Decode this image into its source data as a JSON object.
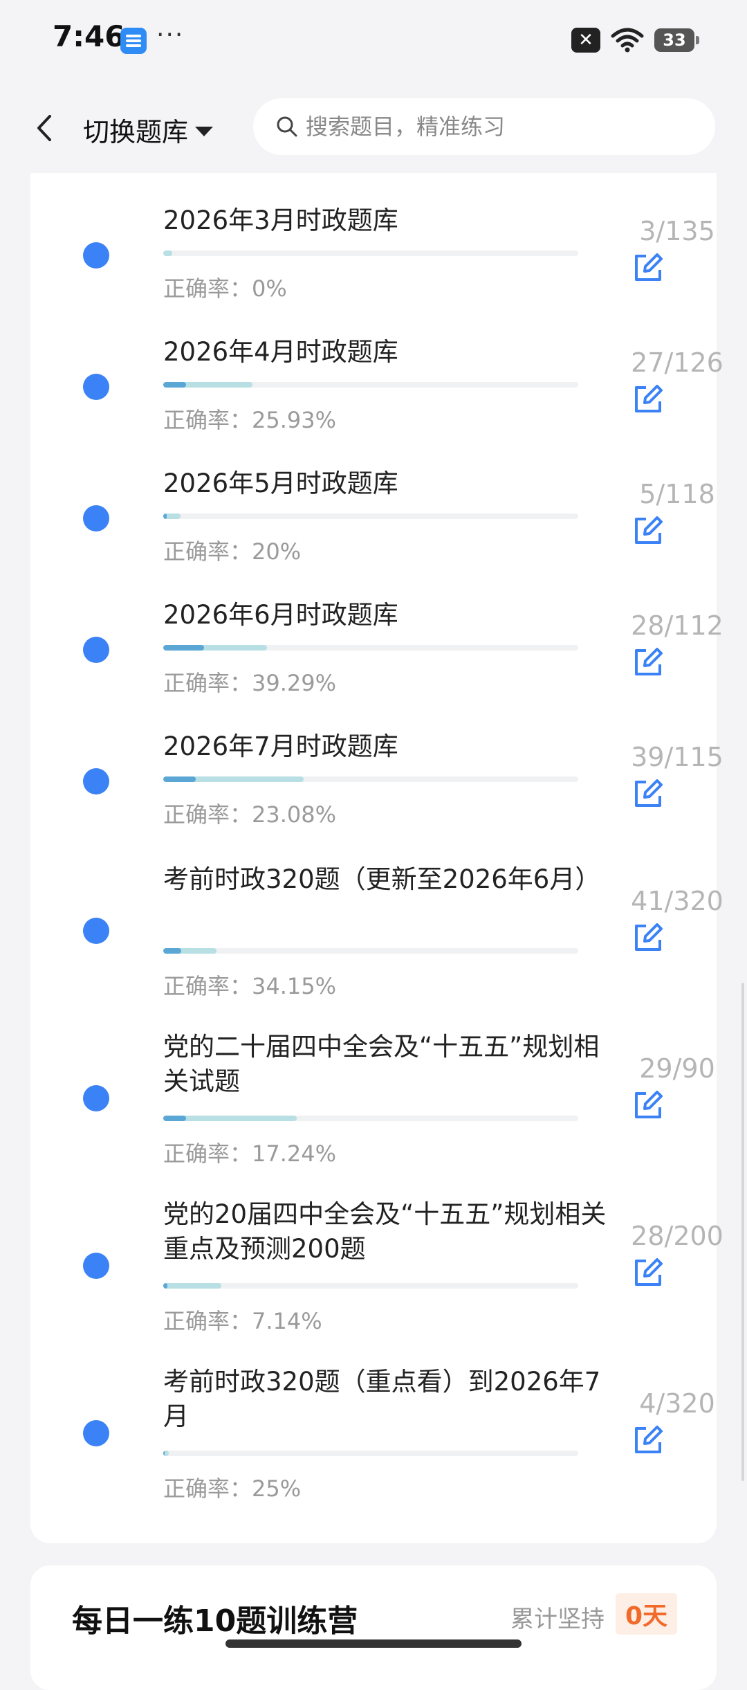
{
  "status_bar": {
    "time": "7:46",
    "more": "···",
    "battery": "33"
  },
  "header": {
    "switch_label": "切换题库",
    "search_placeholder": "搜索题目，精准练习"
  },
  "question_banks": [
    {
      "title": "2026年3月时政题库",
      "accuracy_label": "正确率：0%",
      "progress": "3/135",
      "answered": 3,
      "total": 135,
      "accuracy": 0
    },
    {
      "title": "2026年4月时政题库",
      "accuracy_label": "正确率：25.93%",
      "progress": "27/126",
      "answered": 27,
      "total": 126,
      "accuracy": 25.93
    },
    {
      "title": "2026年5月时政题库",
      "accuracy_label": "正确率：20%",
      "progress": "5/118",
      "answered": 5,
      "total": 118,
      "accuracy": 20
    },
    {
      "title": "2026年6月时政题库",
      "accuracy_label": "正确率：39.29%",
      "progress": "28/112",
      "answered": 28,
      "total": 112,
      "accuracy": 39.29
    },
    {
      "title": "2026年7月时政题库",
      "accuracy_label": "正确率：23.08%",
      "progress": "39/115",
      "answered": 39,
      "total": 115,
      "accuracy": 23.08
    },
    {
      "title": "考前时政320题（更新至2026年6月）",
      "accuracy_label": "正确率：34.15%",
      "progress": "41/320",
      "answered": 41,
      "total": 320,
      "accuracy": 34.15
    },
    {
      "title": "党的二十届四中全会及“十五五”规划相关试题",
      "accuracy_label": "正确率：17.24%",
      "progress": "29/90",
      "answered": 29,
      "total": 90,
      "accuracy": 17.24
    },
    {
      "title": "党的20届四中全会及“十五五”规划相关重点及预测200题",
      "accuracy_label": "正确率：7.14%",
      "progress": "28/200",
      "answered": 28,
      "total": 200,
      "accuracy": 7.14
    },
    {
      "title": "考前时政320题（重点看）到2026年7月",
      "accuracy_label": "正确率：25%",
      "progress": "4/320",
      "answered": 4,
      "total": 320,
      "accuracy": 25
    }
  ],
  "training_camp": {
    "title": "每日一练10题训练营",
    "streak_label": "累计坚持",
    "streak_value": "0天"
  },
  "colors": {
    "dot": "#3b82f6",
    "edit_icon": "#3b82f6",
    "progress_done": "#b7dfe4",
    "progress_correct": "#5aa7d6",
    "streak": "#f26a2a"
  }
}
